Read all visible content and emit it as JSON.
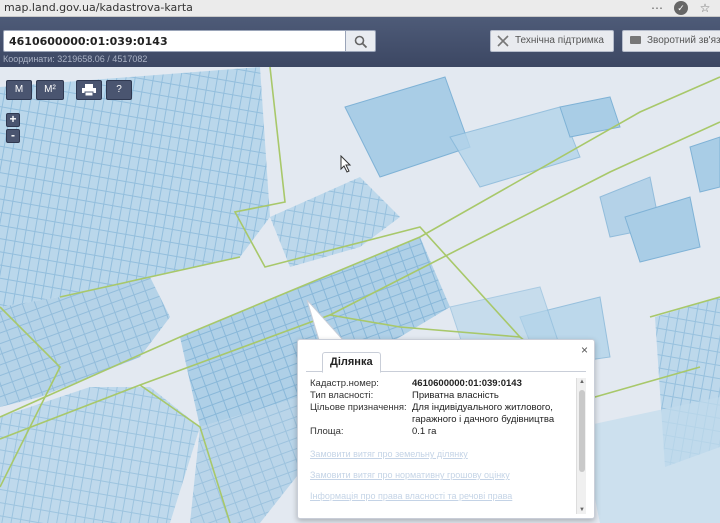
{
  "browser": {
    "url": "map.land.gov.ua/kadastrova-karta"
  },
  "header": {
    "search_value": "4610600000:01:039:0143",
    "coords_text": "Координати: 3219658.06 / 4517082",
    "support_label": "Технічна підтримка",
    "feedback_label": "Зворотний зв'язок"
  },
  "toolbar": {
    "measure_line": "M",
    "measure_area": "M²",
    "print": "print",
    "identify": "?"
  },
  "zoom": {
    "in": "+",
    "out": "-"
  },
  "popup": {
    "close": "×",
    "tab": "Ділянка",
    "rows": [
      {
        "key": "Кадастр.номер:",
        "value": "4610600000:01:039:0143"
      },
      {
        "key": "Тип власності:",
        "value": "Приватна власність"
      },
      {
        "key": "Цільове призначення:",
        "value": "Для індивідуального житлового, гаражного і дачного будівництва"
      },
      {
        "key": "Площа:",
        "value": "0.1 га"
      }
    ],
    "links": [
      "Замовити витяг про земельну ділянку",
      "Замовити витяг про нормативну грошову оцінку",
      "Інформація про права власності та речові права"
    ]
  },
  "colors": {
    "parcel_fill": "#a9cde6",
    "parcel_stroke": "#7fb2d6",
    "boundary": "#a8c86a",
    "header": "#46526e"
  }
}
